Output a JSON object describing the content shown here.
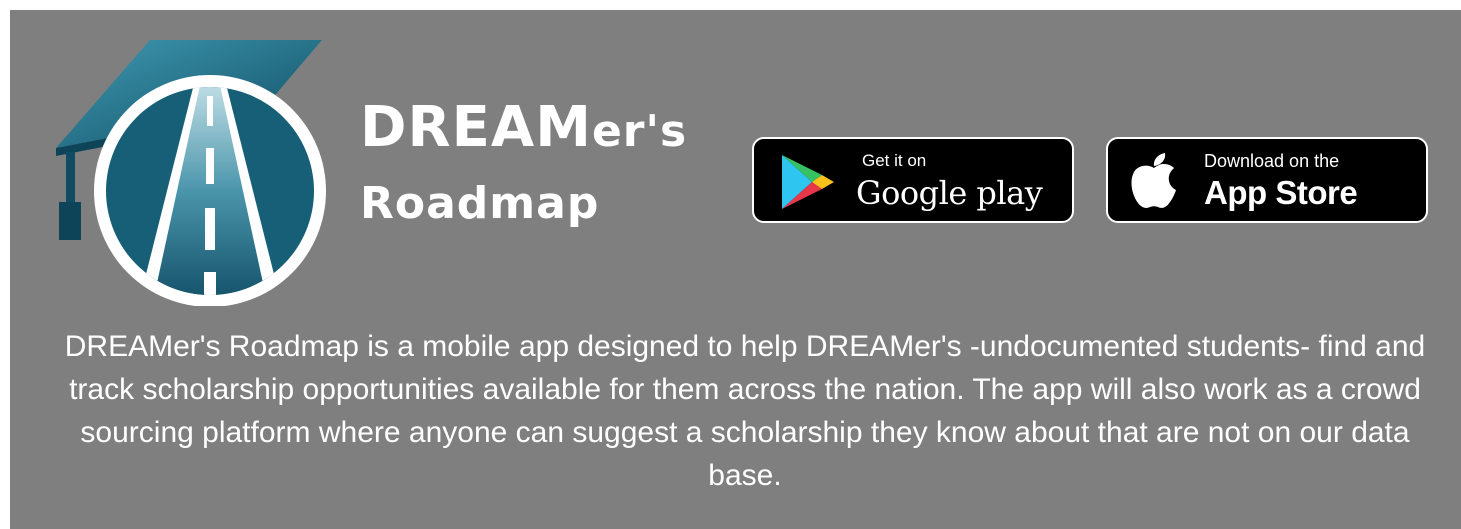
{
  "brand": {
    "line1_caps": "DREAM",
    "line1_rest": "er's",
    "line2": "Roadmap"
  },
  "google_play_button": {
    "small_label": "Get it on",
    "big_label": "Google play",
    "icon": "google-play-icon"
  },
  "app_store_button": {
    "small_label": "Download on the",
    "big_label": "App Store",
    "icon": "apple-icon"
  },
  "description": "DREAMer's Roadmap is a mobile app designed to help DREAMer's -undocumented students- find and track scholarship opportunities available for them across the nation. The app will also work as a crowd sourcing platform where anyone can suggest a scholarship they know about that are not on our data base.",
  "colors": {
    "background": "#7f7f7f",
    "logo_teal": "#1b6f86",
    "logo_dark": "#0f4c63",
    "button_bg": "#000000",
    "text": "#ffffff"
  }
}
